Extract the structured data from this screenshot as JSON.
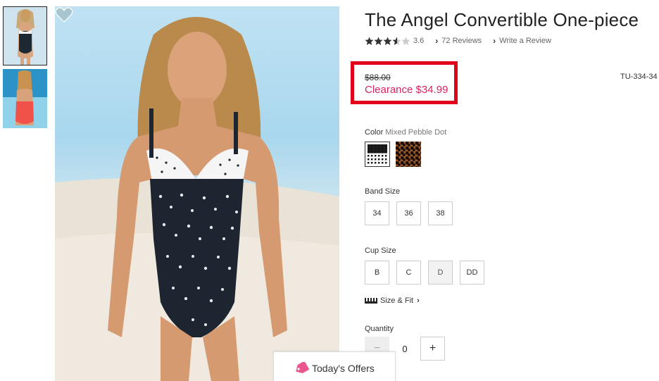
{
  "product": {
    "title": "The Angel Convertible One-piece",
    "rating": 3.6,
    "rating_text": "3.6",
    "reviews_link": "72 Reviews",
    "write_review_link": "Write a Review",
    "sku": "TU-334-34"
  },
  "price": {
    "original": "$88.00",
    "clearance": "Clearance $34.99",
    "clearance_color": "#d6245c",
    "highlight_color": "#e0001a"
  },
  "color": {
    "label": "Color",
    "selected": "Mixed Pebble Dot",
    "swatches": [
      "Mixed Pebble Dot",
      "Leopard"
    ]
  },
  "band_size": {
    "label": "Band Size",
    "options": [
      "34",
      "36",
      "38"
    ]
  },
  "cup_size": {
    "label": "Cup Size",
    "options": [
      "B",
      "C",
      "D",
      "DD"
    ],
    "disabled": [
      "D"
    ]
  },
  "size_fit": {
    "label": "Size & Fit",
    "icon": "ruler-icon"
  },
  "quantity": {
    "label": "Quantity",
    "value": "0",
    "minus": "−",
    "plus": "+"
  },
  "offers": {
    "label": "Today's Offers",
    "icon": "price-tag-icon"
  },
  "icons": {
    "favorite": "heart-icon",
    "chevron": "chevron-right-icon"
  }
}
